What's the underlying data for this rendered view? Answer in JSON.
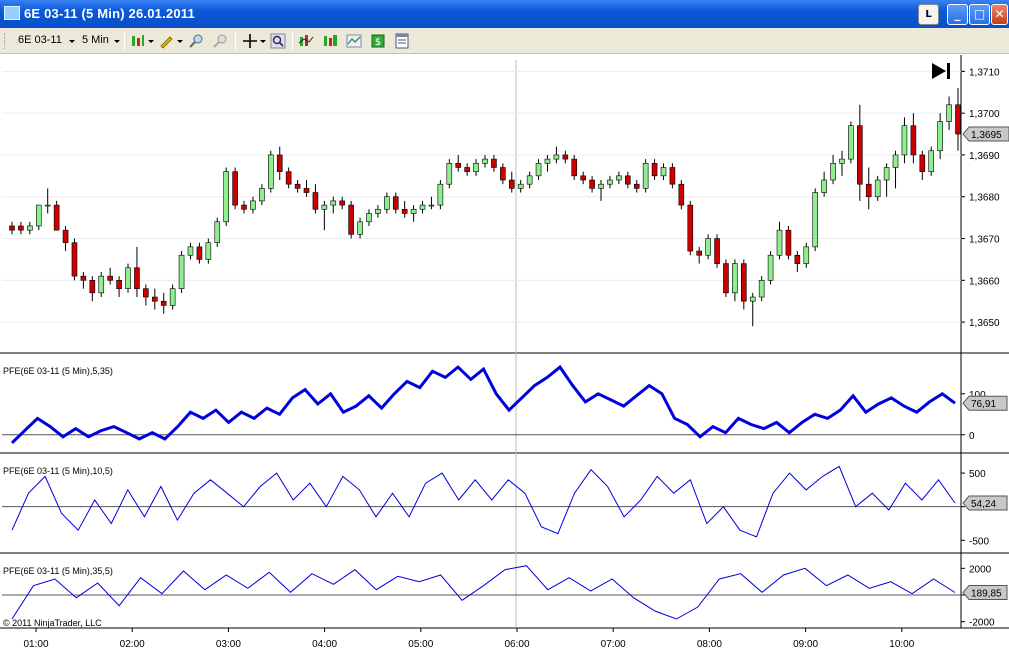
{
  "window": {
    "title": "6E 03-11 (5 Min)  26.01.2011",
    "buttons": {
      "link": "L",
      "minimize": "_",
      "maximize": "□",
      "close": "✕"
    }
  },
  "toolbar": {
    "instrument": "6E 03-11",
    "interval": "5 Min",
    "icons": [
      "bar-type-icon",
      "drawing-pencil-icon",
      "zoom-in-icon",
      "zoom-out-icon",
      "crosshair-icon",
      "search-icon",
      "indicators-icon",
      "strategies-icon",
      "chart-style-icon",
      "money-icon",
      "properties-icon"
    ]
  },
  "chart_data": [
    {
      "type": "candlestick",
      "title": "",
      "price_axis": {
        "ticks": [
          "1,3710",
          "1,3700",
          "1,3690",
          "1,3680",
          "1,3670",
          "1,3660",
          "1,3650"
        ],
        "ylim": [
          1.3645,
          1.3712
        ]
      },
      "last_price_label": "1,3695",
      "x_ticks": [
        "01:00",
        "02:00",
        "03:00",
        "04:00",
        "05:00",
        "06:00",
        "07:00",
        "08:00",
        "09:00",
        "10:00"
      ],
      "up_color": "#90ee90",
      "down_color": "#cc0000",
      "ohlc": [
        [
          1.3673,
          1.3674,
          1.3671,
          1.3672
        ],
        [
          1.3673,
          1.3674,
          1.3671,
          1.3672
        ],
        [
          1.3672,
          1.3674,
          1.3671,
          1.3673
        ],
        [
          1.3673,
          1.3678,
          1.3672,
          1.3678
        ],
        [
          1.3678,
          1.3682,
          1.3676,
          1.3678
        ],
        [
          1.3678,
          1.3679,
          1.3672,
          1.3672
        ],
        [
          1.3672,
          1.3673,
          1.3667,
          1.3669
        ],
        [
          1.3669,
          1.367,
          1.366,
          1.3661
        ],
        [
          1.3661,
          1.3662,
          1.3658,
          1.366
        ],
        [
          1.366,
          1.3661,
          1.3655,
          1.3657
        ],
        [
          1.3657,
          1.3662,
          1.3656,
          1.3661
        ],
        [
          1.3661,
          1.3663,
          1.3659,
          1.366
        ],
        [
          1.366,
          1.3661,
          1.3656,
          1.3658
        ],
        [
          1.3658,
          1.3664,
          1.3657,
          1.3663
        ],
        [
          1.3663,
          1.3668,
          1.3656,
          1.3658
        ],
        [
          1.3658,
          1.3659,
          1.3654,
          1.3656
        ],
        [
          1.3656,
          1.3658,
          1.3653,
          1.3655
        ],
        [
          1.3655,
          1.3657,
          1.3652,
          1.3654
        ],
        [
          1.3654,
          1.3659,
          1.3653,
          1.3658
        ],
        [
          1.3658,
          1.3667,
          1.3657,
          1.3666
        ],
        [
          1.3666,
          1.3669,
          1.3665,
          1.3668
        ],
        [
          1.3668,
          1.3669,
          1.3664,
          1.3665
        ],
        [
          1.3665,
          1.367,
          1.3664,
          1.3669
        ],
        [
          1.3669,
          1.3675,
          1.3668,
          1.3674
        ],
        [
          1.3674,
          1.3687,
          1.3673,
          1.3686
        ],
        [
          1.3686,
          1.3687,
          1.3677,
          1.3678
        ],
        [
          1.3678,
          1.3679,
          1.3676,
          1.3677
        ],
        [
          1.3677,
          1.368,
          1.3676,
          1.3679
        ],
        [
          1.3679,
          1.3683,
          1.3678,
          1.3682
        ],
        [
          1.3682,
          1.3691,
          1.3681,
          1.369
        ],
        [
          1.369,
          1.3692,
          1.3684,
          1.3686
        ],
        [
          1.3686,
          1.3687,
          1.3682,
          1.3683
        ],
        [
          1.3683,
          1.3684,
          1.3681,
          1.3682
        ],
        [
          1.3682,
          1.3684,
          1.368,
          1.3681
        ],
        [
          1.3681,
          1.3683,
          1.3676,
          1.3677
        ],
        [
          1.3677,
          1.3679,
          1.3672,
          1.3678
        ],
        [
          1.3678,
          1.368,
          1.3676,
          1.3679
        ],
        [
          1.3679,
          1.368,
          1.3677,
          1.3678
        ],
        [
          1.3678,
          1.3679,
          1.367,
          1.3671
        ],
        [
          1.3671,
          1.3675,
          1.367,
          1.3674
        ],
        [
          1.3674,
          1.3677,
          1.3673,
          1.3676
        ],
        [
          1.3676,
          1.3678,
          1.3675,
          1.3677
        ],
        [
          1.3677,
          1.3681,
          1.3676,
          1.368
        ],
        [
          1.368,
          1.3681,
          1.3676,
          1.3677
        ],
        [
          1.3677,
          1.3679,
          1.3675,
          1.3676
        ],
        [
          1.3676,
          1.3678,
          1.3674,
          1.3677
        ],
        [
          1.3677,
          1.3679,
          1.3676,
          1.3678
        ],
        [
          1.3678,
          1.368,
          1.3677,
          1.3678
        ],
        [
          1.3678,
          1.3684,
          1.3677,
          1.3683
        ],
        [
          1.3683,
          1.3689,
          1.3682,
          1.3688
        ],
        [
          1.3688,
          1.369,
          1.3686,
          1.3687
        ],
        [
          1.3687,
          1.3688,
          1.3685,
          1.3686
        ],
        [
          1.3686,
          1.3689,
          1.3685,
          1.3688
        ],
        [
          1.3688,
          1.369,
          1.3687,
          1.3689
        ],
        [
          1.3689,
          1.369,
          1.3686,
          1.3687
        ],
        [
          1.3687,
          1.3688,
          1.3683,
          1.3684
        ],
        [
          1.3684,
          1.3686,
          1.3681,
          1.3682
        ],
        [
          1.3682,
          1.3684,
          1.3681,
          1.3683
        ],
        [
          1.3683,
          1.3686,
          1.3682,
          1.3685
        ],
        [
          1.3685,
          1.3689,
          1.3684,
          1.3688
        ],
        [
          1.3688,
          1.369,
          1.3686,
          1.3689
        ],
        [
          1.3689,
          1.3692,
          1.3688,
          1.369
        ],
        [
          1.369,
          1.3691,
          1.3688,
          1.3689
        ],
        [
          1.3689,
          1.369,
          1.3684,
          1.3685
        ],
        [
          1.3685,
          1.3686,
          1.3683,
          1.3684
        ],
        [
          1.3684,
          1.3685,
          1.3681,
          1.3682
        ],
        [
          1.3682,
          1.3684,
          1.3679,
          1.3683
        ],
        [
          1.3683,
          1.3685,
          1.3682,
          1.3684
        ],
        [
          1.3684,
          1.3686,
          1.3683,
          1.3685
        ],
        [
          1.3685,
          1.3686,
          1.3682,
          1.3683
        ],
        [
          1.3683,
          1.3684,
          1.3681,
          1.3682
        ],
        [
          1.3682,
          1.3689,
          1.3681,
          1.3688
        ],
        [
          1.3688,
          1.3689,
          1.3684,
          1.3685
        ],
        [
          1.3685,
          1.3688,
          1.3684,
          1.3687
        ],
        [
          1.3687,
          1.3688,
          1.3682,
          1.3683
        ],
        [
          1.3683,
          1.3684,
          1.3677,
          1.3678
        ],
        [
          1.3678,
          1.3679,
          1.3666,
          1.3667
        ],
        [
          1.3667,
          1.3668,
          1.3664,
          1.3666
        ],
        [
          1.3666,
          1.3671,
          1.3665,
          1.367
        ],
        [
          1.367,
          1.3671,
          1.3663,
          1.3664
        ],
        [
          1.3664,
          1.3665,
          1.3656,
          1.3657
        ],
        [
          1.3657,
          1.3665,
          1.3655,
          1.3664
        ],
        [
          1.3664,
          1.3665,
          1.3653,
          1.3655
        ],
        [
          1.3655,
          1.3657,
          1.3649,
          1.3656
        ],
        [
          1.3656,
          1.3661,
          1.3655,
          1.366
        ],
        [
          1.366,
          1.3667,
          1.3659,
          1.3666
        ],
        [
          1.3666,
          1.3674,
          1.3665,
          1.3672
        ],
        [
          1.3672,
          1.3673,
          1.3665,
          1.3666
        ],
        [
          1.3666,
          1.3667,
          1.3662,
          1.3664
        ],
        [
          1.3664,
          1.3669,
          1.3663,
          1.3668
        ],
        [
          1.3668,
          1.3682,
          1.3667,
          1.3681
        ],
        [
          1.3681,
          1.3686,
          1.368,
          1.3684
        ],
        [
          1.3684,
          1.369,
          1.3683,
          1.3688
        ],
        [
          1.3688,
          1.3691,
          1.3685,
          1.3689
        ],
        [
          1.3689,
          1.3698,
          1.3688,
          1.3697
        ],
        [
          1.3697,
          1.3702,
          1.3679,
          1.3683
        ],
        [
          1.3683,
          1.3687,
          1.3677,
          1.368
        ],
        [
          1.368,
          1.3685,
          1.3679,
          1.3684
        ],
        [
          1.3684,
          1.3688,
          1.368,
          1.3687
        ],
        [
          1.3687,
          1.3691,
          1.3682,
          1.369
        ],
        [
          1.369,
          1.3699,
          1.3688,
          1.3697
        ],
        [
          1.3697,
          1.37,
          1.3688,
          1.369
        ],
        [
          1.369,
          1.3691,
          1.3684,
          1.3686
        ],
        [
          1.3686,
          1.3692,
          1.3685,
          1.3691
        ],
        [
          1.3691,
          1.37,
          1.3689,
          1.3698
        ],
        [
          1.3698,
          1.3704,
          1.3696,
          1.3702
        ],
        [
          1.3702,
          1.3706,
          1.3691,
          1.3695
        ]
      ]
    },
    {
      "type": "line",
      "label": "PFE(6E 03-11 (5 Min),5,35)",
      "ticks": [
        "100",
        "0"
      ],
      "last_label": "76,91",
      "color": "#0000dd",
      "line_width": "thick",
      "ylim": [
        -25,
        175
      ],
      "values": [
        -20,
        10,
        40,
        20,
        -5,
        15,
        -5,
        10,
        20,
        5,
        -10,
        5,
        -10,
        20,
        55,
        40,
        60,
        30,
        55,
        40,
        65,
        50,
        90,
        110,
        75,
        100,
        55,
        70,
        95,
        65,
        100,
        130,
        115,
        155,
        140,
        165,
        135,
        160,
        100,
        60,
        90,
        120,
        140,
        165,
        120,
        80,
        100,
        85,
        70,
        95,
        120,
        100,
        40,
        25,
        -5,
        20,
        5,
        40,
        25,
        15,
        30,
        5,
        30,
        50,
        40,
        60,
        95,
        55,
        75,
        90,
        70,
        55,
        80,
        100,
        76.91
      ]
    },
    {
      "type": "line",
      "label": "PFE(6E 03-11 (5 Min),10,5)",
      "ticks": [
        "500",
        "0",
        "-500"
      ],
      "last_label": "54,24",
      "color": "#0000dd",
      "line_width": "thin",
      "ylim": [
        -600,
        650
      ],
      "values": [
        -350,
        200,
        450,
        -100,
        -350,
        100,
        -250,
        250,
        -150,
        300,
        -200,
        200,
        400,
        200,
        0,
        300,
        500,
        100,
        350,
        0,
        450,
        250,
        -150,
        200,
        -150,
        350,
        500,
        100,
        400,
        100,
        400,
        200,
        -300,
        -400,
        200,
        550,
        300,
        -150,
        100,
        450,
        200,
        400,
        -250,
        0,
        -350,
        -450,
        200,
        500,
        250,
        450,
        600,
        0,
        200,
        -50,
        350,
        100,
        400,
        54.24
      ]
    },
    {
      "type": "line",
      "label": "PFE(6E 03-11 (5 Min),35,5)",
      "ticks": [
        "2000",
        "0",
        "-2000"
      ],
      "last_label": "189,85",
      "color": "#0000dd",
      "line_width": "thin",
      "ylim": [
        -2400,
        2400
      ],
      "values": [
        -1800,
        700,
        1200,
        -200,
        900,
        -800,
        1300,
        100,
        1800,
        400,
        1500,
        500,
        1700,
        200,
        1600,
        800,
        1900,
        400,
        1400,
        1000,
        1500,
        -400,
        700,
        1900,
        2200,
        400,
        1300,
        300,
        1200,
        -200,
        -1200,
        -1800,
        -900,
        1200,
        1600,
        200,
        1500,
        2000,
        700,
        1500,
        500,
        1000,
        100,
        1200,
        189.85
      ]
    }
  ],
  "copyright": "© 2011 NinjaTrader, LLC"
}
